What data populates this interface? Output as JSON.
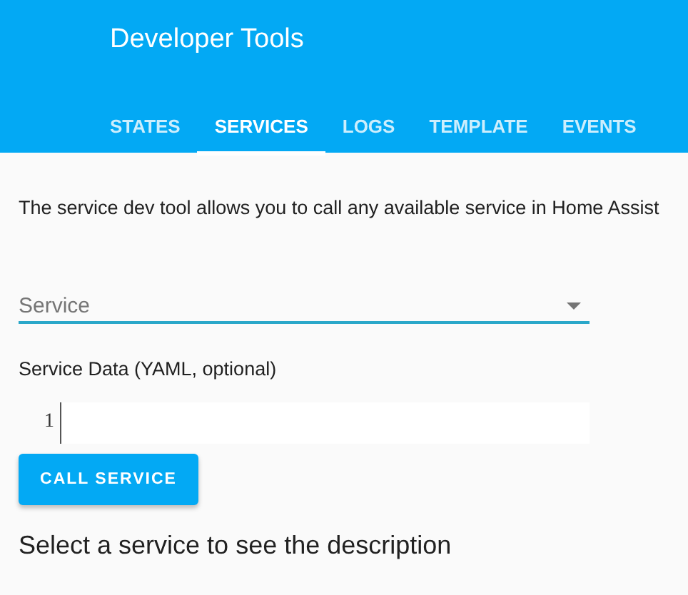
{
  "header": {
    "title": "Developer Tools"
  },
  "tabs": [
    {
      "label": "STATES",
      "selected": false
    },
    {
      "label": "SERVICES",
      "selected": true
    },
    {
      "label": "LOGS",
      "selected": false
    },
    {
      "label": "TEMPLATE",
      "selected": false
    },
    {
      "label": "EVENTS",
      "selected": false
    }
  ],
  "intro": "The service dev tool allows you to call any available service in Home Assist",
  "service_select": {
    "placeholder": "Service"
  },
  "service_data": {
    "label": "Service Data (YAML, optional)",
    "line_numbers": [
      "1"
    ]
  },
  "call_button": "CALL SERVICE",
  "description_heading": "Select a service to see the description"
}
